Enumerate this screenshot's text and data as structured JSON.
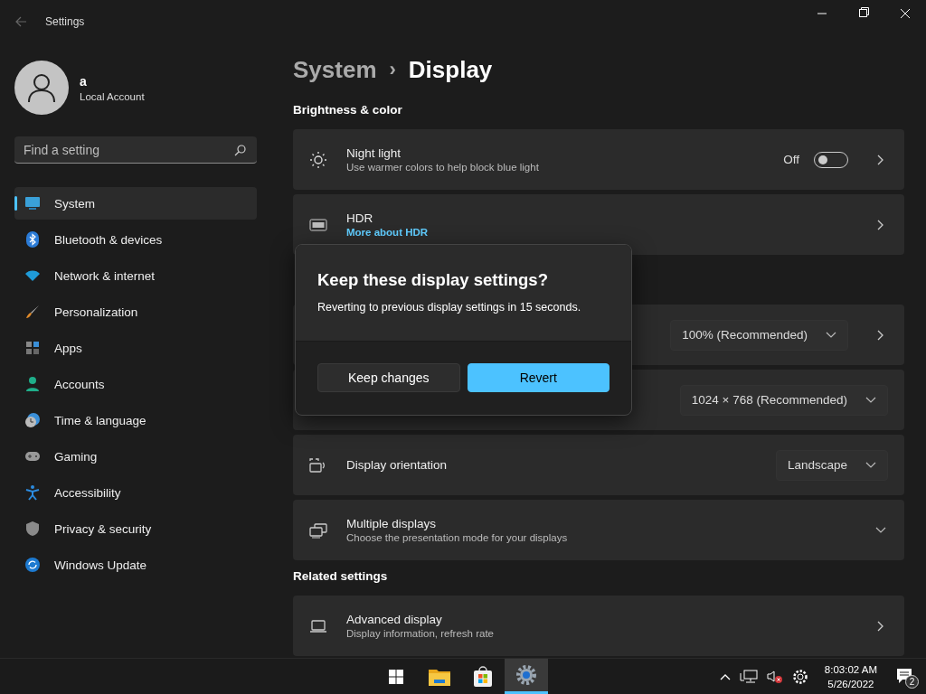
{
  "window": {
    "title": "Settings"
  },
  "account": {
    "name": "a",
    "type": "Local Account"
  },
  "search": {
    "placeholder": "Find a setting"
  },
  "sidebar": {
    "items": [
      {
        "label": "System",
        "selected": true
      },
      {
        "label": "Bluetooth & devices",
        "selected": false
      },
      {
        "label": "Network & internet",
        "selected": false
      },
      {
        "label": "Personalization",
        "selected": false
      },
      {
        "label": "Apps",
        "selected": false
      },
      {
        "label": "Accounts",
        "selected": false
      },
      {
        "label": "Time & language",
        "selected": false
      },
      {
        "label": "Gaming",
        "selected": false
      },
      {
        "label": "Accessibility",
        "selected": false
      },
      {
        "label": "Privacy & security",
        "selected": false
      },
      {
        "label": "Windows Update",
        "selected": false
      }
    ]
  },
  "breadcrumb": {
    "parent": "System",
    "separator": "›",
    "current": "Display"
  },
  "sections": [
    {
      "heading": "Brightness & color",
      "rows": [
        {
          "kind": "toggle",
          "title": "Night light",
          "subtitle": "Use warmer colors to help block blue light",
          "state_label": "Off",
          "on": false,
          "chevron": true
        },
        {
          "kind": "link",
          "title": "HDR",
          "link": "More about HDR",
          "chevron": true
        }
      ]
    },
    {
      "rows": [
        {
          "kind": "dropdown",
          "value": "100% (Recommended)",
          "chevron": true
        },
        {
          "kind": "dropdown",
          "value": "1024 × 768 (Recommended)",
          "chevron": false
        },
        {
          "kind": "dropdown",
          "title": "Display orientation",
          "value": "Landscape",
          "chevron": false
        },
        {
          "kind": "expand",
          "title": "Multiple displays",
          "subtitle": "Choose the presentation mode for your displays"
        }
      ]
    },
    {
      "heading": "Related settings",
      "rows": [
        {
          "kind": "plain",
          "title": "Advanced display",
          "subtitle": "Display information, refresh rate",
          "chevron": true
        }
      ]
    }
  ],
  "dialog": {
    "title": "Keep these display settings?",
    "message": "Reverting to previous display settings in 15 seconds.",
    "buttons": [
      {
        "label": "Keep changes",
        "primary": false
      },
      {
        "label": "Revert",
        "primary": true
      }
    ]
  },
  "taskbar": {
    "apps": [
      {
        "active": false
      },
      {
        "active": false
      },
      {
        "active": false
      },
      {
        "active": true
      }
    ],
    "time": "8:03:02 AM",
    "date": "5/26/2022",
    "notifications": "2"
  }
}
